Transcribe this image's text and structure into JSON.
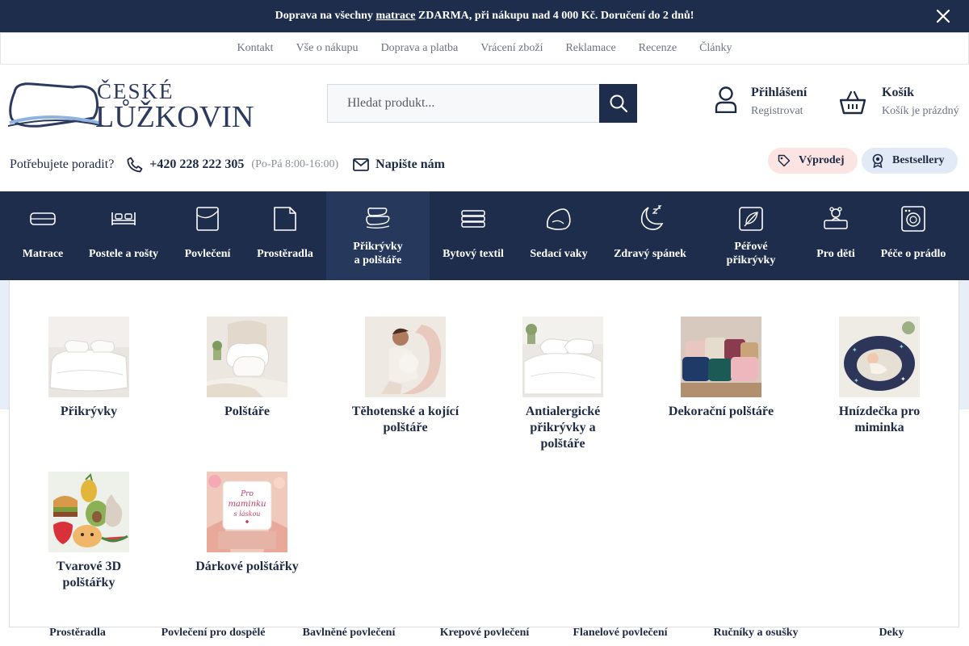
{
  "promo": {
    "prefix": "Doprava na všechny",
    "link": "matrace",
    "suffix": "ZDARMA, při nákupu nad 4 000 Kč. Doručení do 2 dnů!",
    "close_icon": "close-icon"
  },
  "subnav": [
    "Kontakt",
    "Vše o nákupu",
    "Doprava a platba",
    "Vrácení zboží",
    "Reklamace",
    "Recenze",
    "Články"
  ],
  "logo": {
    "line1": "ČESKÉ",
    "line2": "LŮŽKOVINY"
  },
  "search": {
    "placeholder": "Hledat produkt..."
  },
  "account": {
    "title": "Přihlášení",
    "subtitle": "Registrovat"
  },
  "cart": {
    "title": "Košík",
    "subtitle": "Košík je prázdný"
  },
  "contact": {
    "help": "Potřebujete poradit?",
    "phone": "+420 228 222 305",
    "hours": "(Po-Pá 8:00-16:00)",
    "mail": "Napište nám"
  },
  "pills": {
    "sale": "Výprodej",
    "best": "Bestsellery"
  },
  "nav": [
    {
      "label": "Matrace",
      "icon": "mattress-icon"
    },
    {
      "label": "Postele a rošty",
      "icon": "bed-icon"
    },
    {
      "label": "Povlečení",
      "icon": "bedding-icon"
    },
    {
      "label": "Prostěradla",
      "icon": "sheet-icon"
    },
    {
      "label": "Přikrývky a polštáře",
      "icon": "pillow-stack-icon"
    },
    {
      "label": "Bytový textil",
      "icon": "textile-icon"
    },
    {
      "label": "Sedací vaky",
      "icon": "beanbag-icon"
    },
    {
      "label": "Zdravý spánek",
      "icon": "moon-icon"
    },
    {
      "label": "Péřové přikrývky",
      "icon": "feather-icon"
    },
    {
      "label": "Pro děti",
      "icon": "teddy-bear-icon"
    },
    {
      "label": "Péče o prádlo",
      "icon": "washing-machine-icon"
    }
  ],
  "dropdown": [
    {
      "label": "Přikrývky"
    },
    {
      "label": "Polštáře"
    },
    {
      "label": "Těhotenské a kojící polštáře"
    },
    {
      "label": "Antialergické přikrývky a polštáře"
    },
    {
      "label": "Dekorační polštáře"
    },
    {
      "label": "Hnízdečka pro miminka"
    },
    {
      "label": "Tvarové 3D polštářky"
    },
    {
      "label": "Dárkové polštářky",
      "image_text": "Pro maminku s láskou"
    }
  ],
  "peek": [
    "Prostěradla",
    "Povlečení pro dospělé",
    "Bavlněné povlečení",
    "Krepové povlečení",
    "Flanelové povlečení",
    "Ručníky a osušky",
    "Deky"
  ],
  "colors": {
    "navy": "#1f2d4d",
    "active": "#26395d",
    "sale_bg": "#fbe4e2",
    "best_bg": "#e1eaf6"
  }
}
